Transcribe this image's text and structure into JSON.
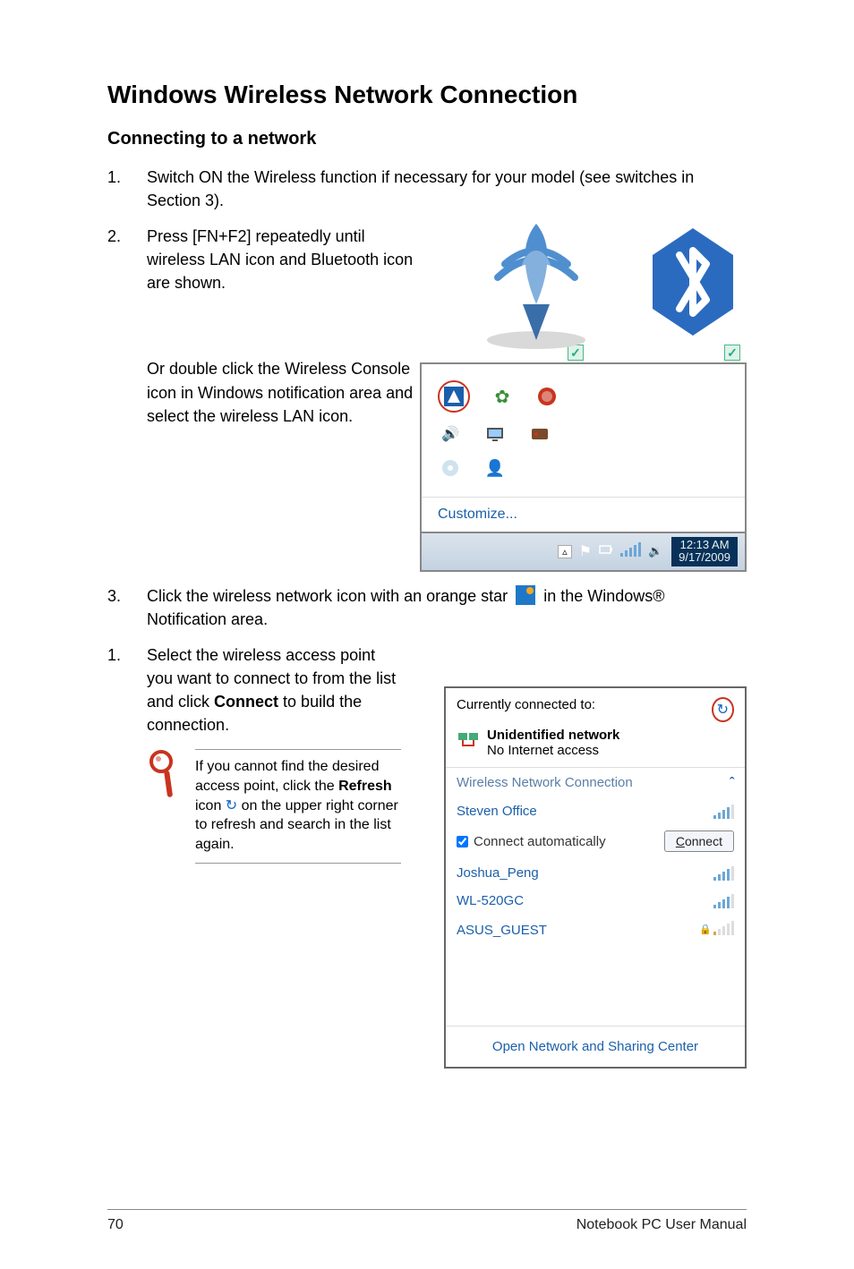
{
  "title": "Windows Wireless Network Connection",
  "subtitle": "Connecting to a network",
  "steps": {
    "s1": "Switch ON the Wireless function if necessary for your model (see switches in Section 3).",
    "s2": "Press [FN+F2] repeatedly until wireless LAN icon and Bluetooth icon are shown.",
    "s2b": "Or double click the Wireless Console icon in Windows notification area and select the wireless LAN icon.",
    "s3a": "Click the wireless network icon with an orange star ",
    "s3b": " in the Windows® Notification area.",
    "s4a": "Select the wireless access point you want to connect to from the list and click ",
    "s4bold": "Connect",
    "s4b": " to build the connection."
  },
  "tip": {
    "a": "If you cannot find the desired access point, click the ",
    "bold": "Refresh",
    "b": " icon ",
    "c": " on the upper right corner to refresh and search in the list again."
  },
  "tray": {
    "customize": "Customize...",
    "time": "12:13 AM",
    "date": "9/17/2009"
  },
  "popup": {
    "currently": "Currently connected to:",
    "net_name": "Unidentified network",
    "net_status": "No Internet access",
    "section": "Wireless Network Connection",
    "items": [
      {
        "name": "Steven Office",
        "signal": "s4"
      },
      {
        "name": "Joshua_Peng",
        "signal": "s4"
      },
      {
        "name": "WL-520GC",
        "signal": "s4"
      },
      {
        "name": "ASUS_GUEST",
        "signal": "s1",
        "lock": true
      }
    ],
    "connect_auto": "Connect automatically",
    "connect_btn_pre": "C",
    "connect_btn_rest": "onnect",
    "footer": "Open Network and Sharing Center"
  },
  "footer": {
    "page": "70",
    "doc": "Notebook PC User Manual"
  },
  "glyphs": {
    "chevron_up": "⌃",
    "refresh": "↻"
  }
}
